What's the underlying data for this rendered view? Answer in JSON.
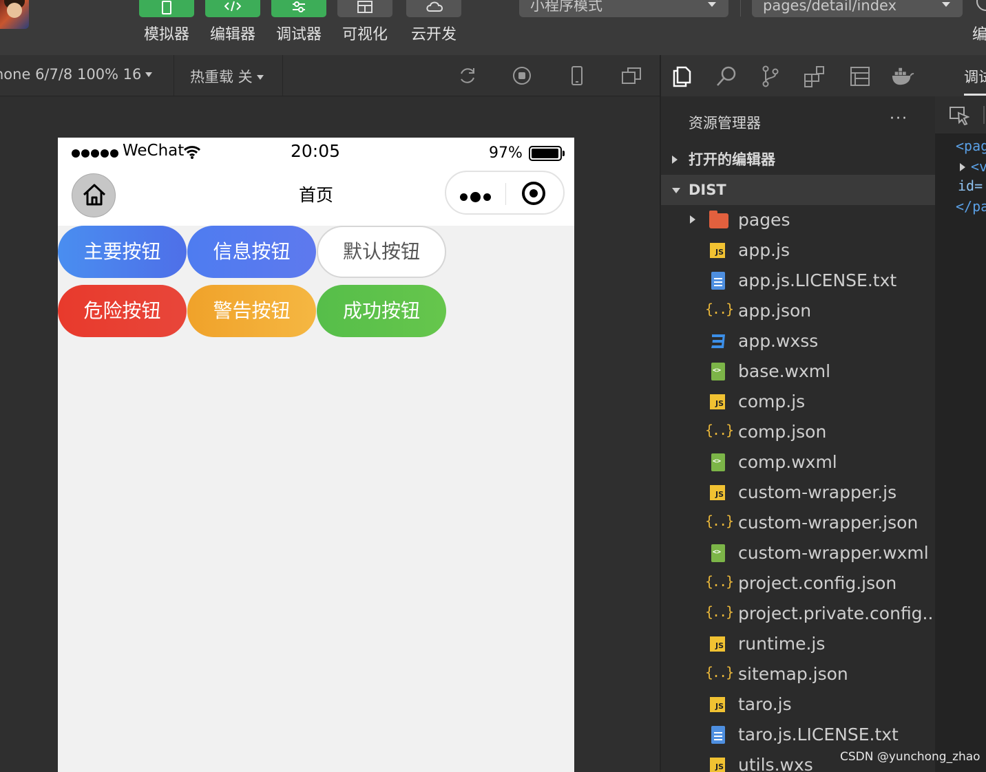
{
  "toolbar": {
    "tools": [
      {
        "label": "模拟器",
        "active": true
      },
      {
        "label": "编辑器",
        "active": true
      },
      {
        "label": "调试器",
        "active": true
      },
      {
        "label": "可视化",
        "active": false
      },
      {
        "label": "云开发",
        "active": false
      }
    ],
    "mode": "小程序模式",
    "page_path": "pages/detail/index",
    "right_cut_label": "编"
  },
  "simulator_bar": {
    "device": "hone 6/7/8 100% 16",
    "hot_reload": "热重载 关"
  },
  "phone": {
    "status": {
      "carrier": "WeChat",
      "time": "20:05",
      "battery": "97%",
      "battery_level": 0.97
    },
    "nav_title": "首页",
    "buttons": [
      {
        "label": "主要按钮",
        "type": "primary"
      },
      {
        "label": "信息按钮",
        "type": "info"
      },
      {
        "label": "默认按钮",
        "type": "default"
      },
      {
        "label": "危险按钮",
        "type": "danger"
      },
      {
        "label": "警告按钮",
        "type": "warning"
      },
      {
        "label": "成功按钮",
        "type": "success"
      }
    ]
  },
  "activity": {
    "icons": [
      "files-icon",
      "search-icon",
      "source-control-icon",
      "extensions-icon",
      "layout-icon",
      "docker-icon"
    ],
    "cut_tab_label": "调试"
  },
  "explorer": {
    "title": "资源管理器",
    "more": "···",
    "open_editors": "打开的编辑器",
    "root": "DIST",
    "files": [
      {
        "name": "pages",
        "kind": "folder"
      },
      {
        "name": "app.js",
        "kind": "js"
      },
      {
        "name": "app.js.LICENSE.txt",
        "kind": "txt"
      },
      {
        "name": "app.json",
        "kind": "json"
      },
      {
        "name": "app.wxss",
        "kind": "css"
      },
      {
        "name": "base.wxml",
        "kind": "wxml"
      },
      {
        "name": "comp.js",
        "kind": "js"
      },
      {
        "name": "comp.json",
        "kind": "json"
      },
      {
        "name": "comp.wxml",
        "kind": "wxml"
      },
      {
        "name": "custom-wrapper.js",
        "kind": "js"
      },
      {
        "name": "custom-wrapper.json",
        "kind": "json"
      },
      {
        "name": "custom-wrapper.wxml",
        "kind": "wxml"
      },
      {
        "name": "project.config.json",
        "kind": "json"
      },
      {
        "name": "project.private.config...",
        "kind": "json"
      },
      {
        "name": "runtime.js",
        "kind": "js"
      },
      {
        "name": "sitemap.json",
        "kind": "json"
      },
      {
        "name": "taro.js",
        "kind": "js"
      },
      {
        "name": "taro.js.LICENSE.txt",
        "kind": "txt"
      },
      {
        "name": "utils.wxs",
        "kind": "js"
      }
    ]
  },
  "code": {
    "lines": [
      "<pag",
      "<v",
      "id=",
      "</pa"
    ]
  },
  "watermark": "CSDN @yunchong_zhao",
  "colors": {
    "accent_green": "#3dad58",
    "primary": "#4a8ef0",
    "danger": "#e83a2c",
    "warning": "#f0a22a",
    "success": "#56be4a"
  }
}
